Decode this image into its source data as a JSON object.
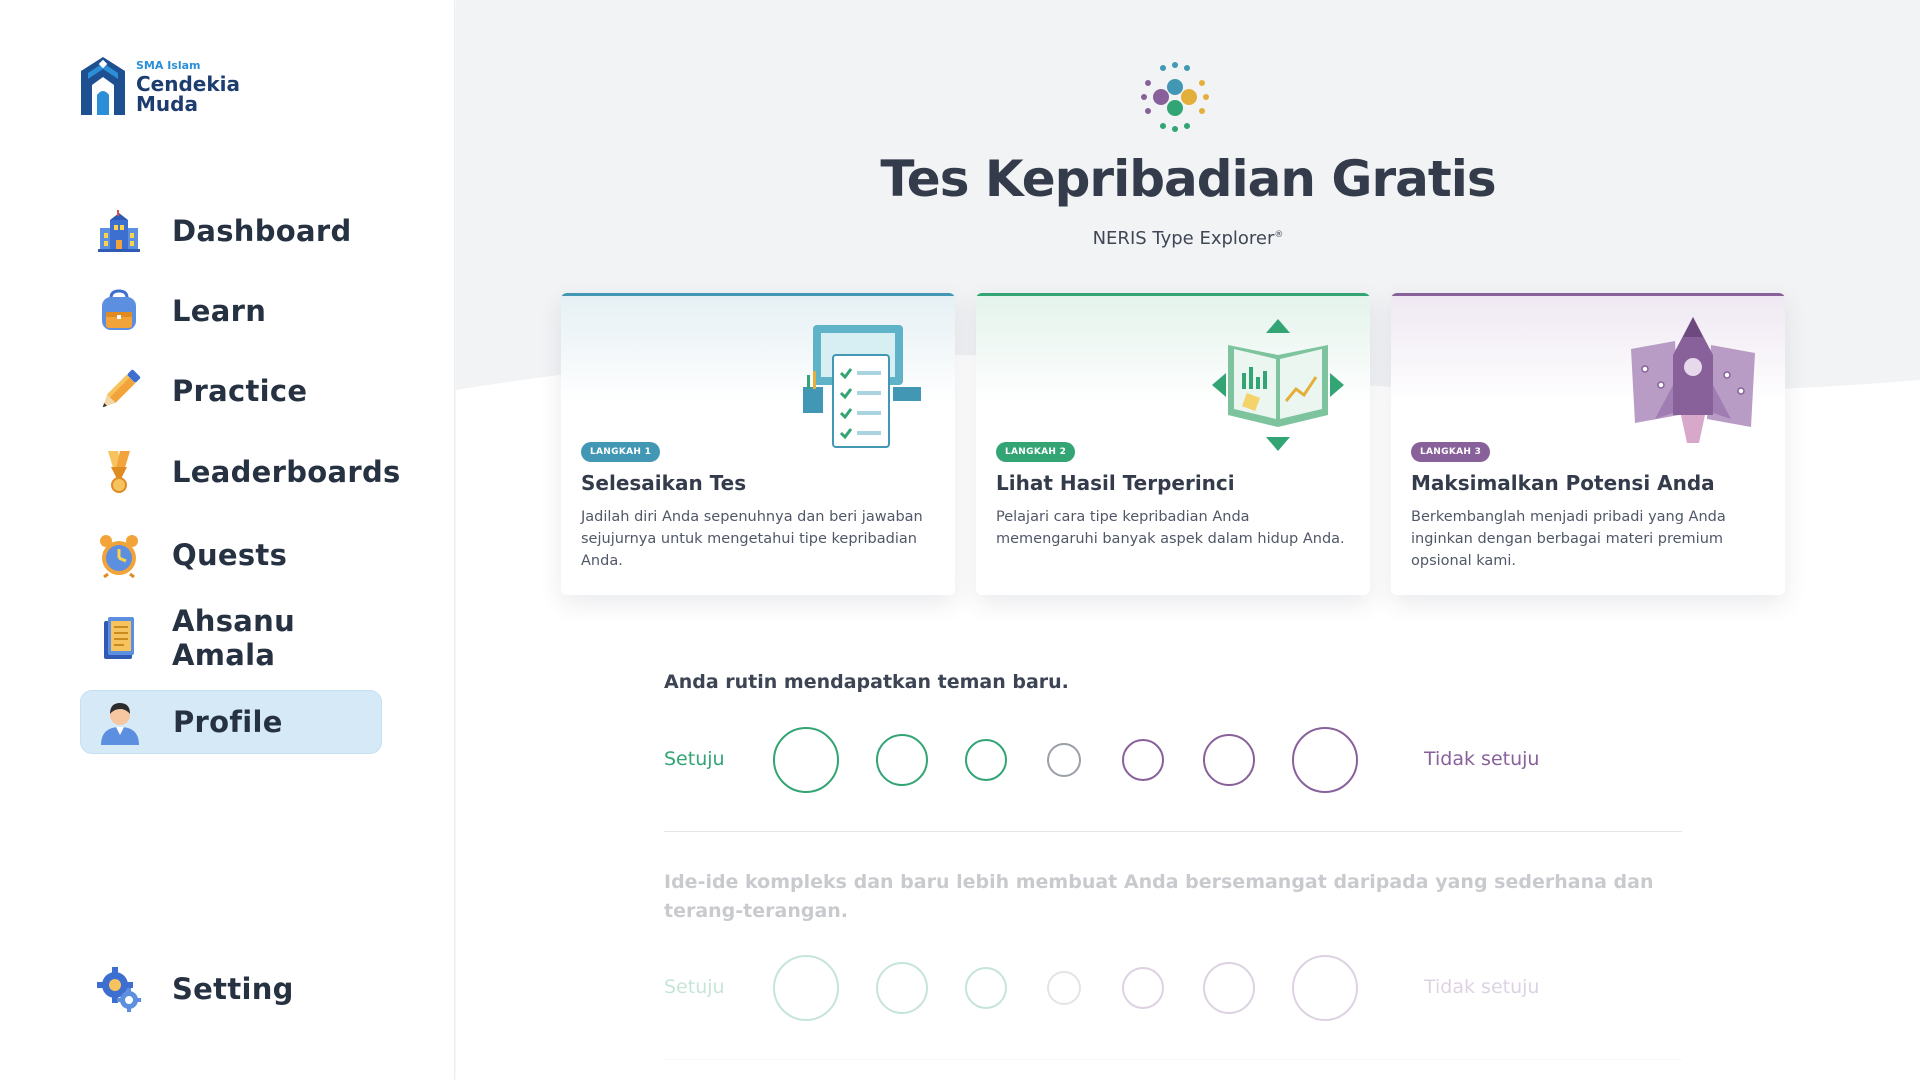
{
  "brand": {
    "small": "SMA Islam",
    "line1": "Cendekia",
    "line2": "Muda"
  },
  "sidebar": {
    "items": [
      {
        "label": "Dashboard",
        "icon": "school-building-icon"
      },
      {
        "label": "Learn",
        "icon": "backpack-icon"
      },
      {
        "label": "Practice",
        "icon": "pencil-icon"
      },
      {
        "label": "Leaderboards",
        "icon": "medal-icon"
      },
      {
        "label": "Quests",
        "icon": "alarm-clock-icon"
      },
      {
        "label": "Ahsanu Amala",
        "icon": "notebook-icon"
      },
      {
        "label": "Profile",
        "icon": "user-icon",
        "active": true
      }
    ],
    "setting": {
      "label": "Setting",
      "icon": "gear-icon"
    }
  },
  "hero": {
    "title": "Tes Kepribadian Gratis",
    "subtitle": "NERIS Type Explorer",
    "subtitle_mark": "®"
  },
  "steps": [
    {
      "badge": "LANGKAH 1",
      "title": "Selesaikan Tes",
      "text": "Jadilah diri Anda sepenuhnya dan beri jawaban sejujurnya untuk mengetahui tipe kepribadian Anda.",
      "color": "#4298b4",
      "icon": "test-checklist-icon"
    },
    {
      "badge": "LANGKAH 2",
      "title": "Lihat Hasil Terperinci",
      "text": "Pelajari cara tipe kepribadian Anda memengaruhi banyak aspek dalam hidup Anda.",
      "color": "#33a474",
      "icon": "results-book-icon"
    },
    {
      "badge": "LANGKAH 3",
      "title": "Maksimalkan Potensi Anda",
      "text": "Berkembanglah menjadi pribadi yang Anda inginkan dengan berbagai materi premium opsional kami.",
      "color": "#88619a",
      "icon": "rocket-icon"
    }
  ],
  "questions": [
    {
      "text": "Anda rutin mendapatkan teman baru.",
      "agree": "Setuju",
      "disagree": "Tidak setuju"
    },
    {
      "text": "Ide-ide kompleks dan baru lebih membuat Anda bersemangat daripada yang sederhana dan terang-terangan.",
      "agree": "Setuju",
      "disagree": "Tidak setuju"
    }
  ],
  "colors": {
    "agree": "#33a474",
    "disagree": "#88619a",
    "neutral": "#9aa0a6",
    "active_nav": "#d6e9f7"
  }
}
